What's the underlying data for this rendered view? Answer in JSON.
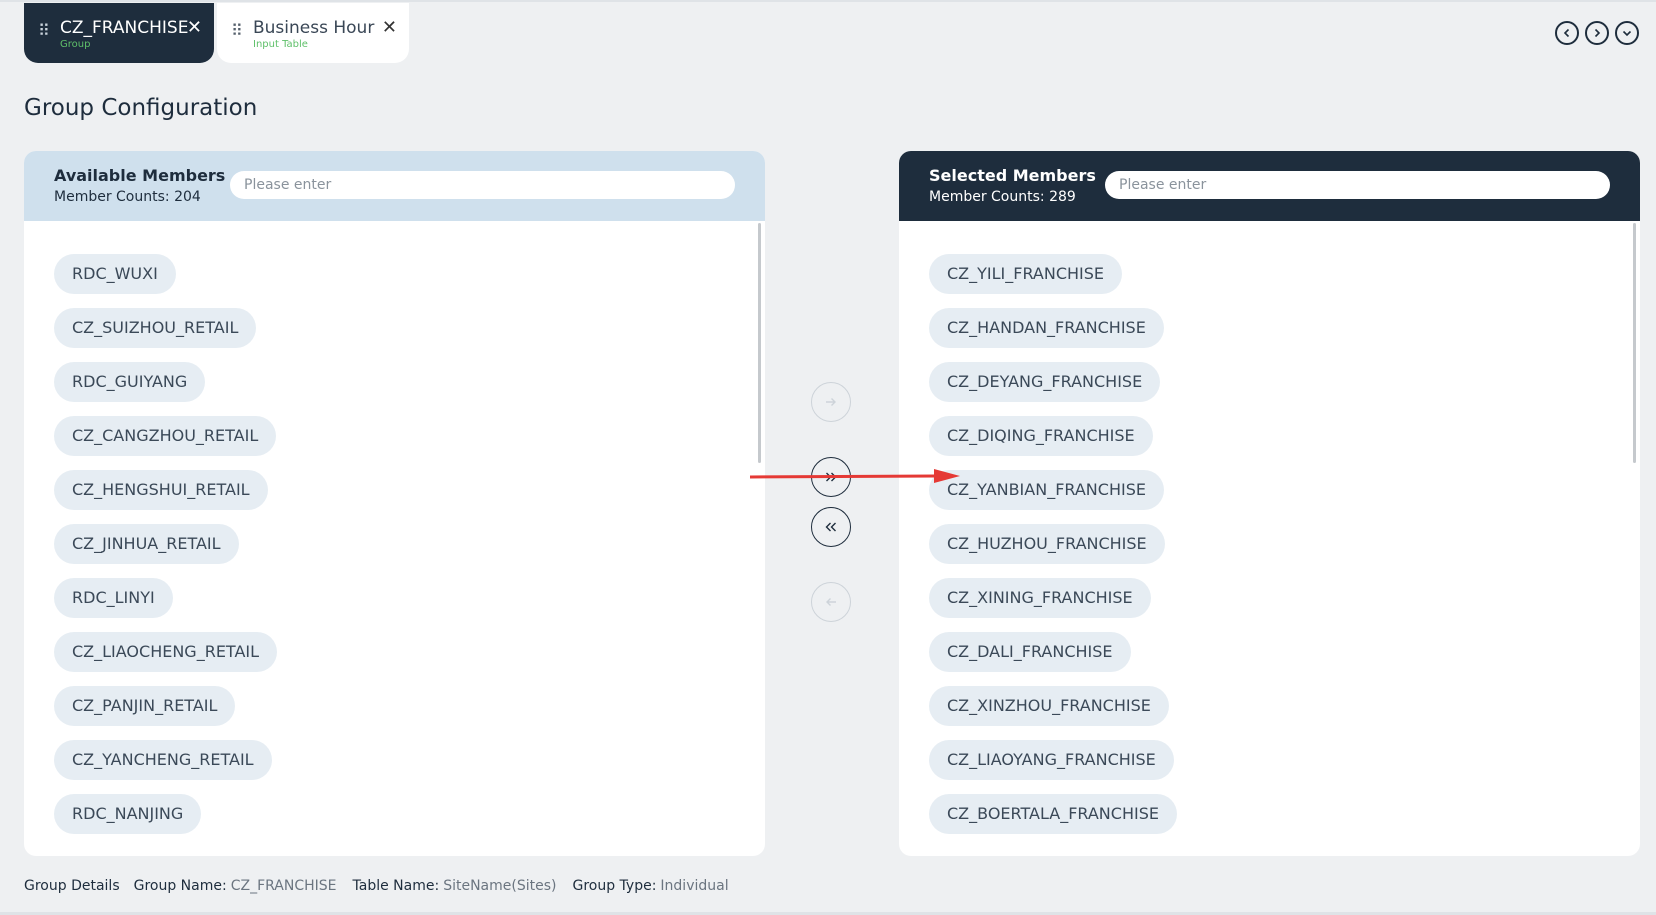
{
  "tabs": [
    {
      "title": "CZ_FRANCHISE",
      "subtitle": "Group",
      "close": "✕"
    },
    {
      "title": "Business Hour",
      "subtitle": "Input Table",
      "close": "✕"
    }
  ],
  "nav": {
    "icons": [
      "chevron-left-icon",
      "chevron-right-icon",
      "chevron-down-icon"
    ]
  },
  "page": {
    "title": "Group Configuration"
  },
  "available": {
    "title": "Available Members",
    "count_label": "Member Counts:",
    "count": "204",
    "search_placeholder": "Please enter",
    "items": [
      "RDC_WUXI",
      "CZ_SUIZHOU_RETAIL",
      "RDC_GUIYANG",
      "CZ_CANGZHOU_RETAIL",
      "CZ_HENGSHUI_RETAIL",
      "CZ_JINHUA_RETAIL",
      "RDC_LINYI",
      "CZ_LIAOCHENG_RETAIL",
      "CZ_PANJIN_RETAIL",
      "CZ_YANCHENG_RETAIL",
      "RDC_NANJING"
    ]
  },
  "selected": {
    "title": "Selected Members",
    "count_label": "Member Counts:",
    "count": "289",
    "search_placeholder": "Please enter",
    "items": [
      "CZ_YILI_FRANCHISE",
      "CZ_HANDAN_FRANCHISE",
      "CZ_DEYANG_FRANCHISE",
      "CZ_DIQING_FRANCHISE",
      "CZ_YANBIAN_FRANCHISE",
      "CZ_HUZHOU_FRANCHISE",
      "CZ_XINING_FRANCHISE",
      "CZ_DALI_FRANCHISE",
      "CZ_XINZHOU_FRANCHISE",
      "CZ_LIAOYANG_FRANCHISE",
      "CZ_BOERTALA_FRANCHISE"
    ]
  },
  "transfer": {
    "move_right": {
      "icon": "arrow-right-icon",
      "enabled": false
    },
    "move_all_right": {
      "icon": "double-chevron-right-icon",
      "enabled": true
    },
    "move_all_left": {
      "icon": "double-chevron-left-icon",
      "enabled": true
    },
    "move_left": {
      "icon": "arrow-left-icon",
      "enabled": false
    }
  },
  "annotation": {
    "color": "#e53935"
  },
  "footer": {
    "details_label": "Group Details",
    "group_name_label": "Group Name:",
    "group_name": "CZ_FRANCHISE",
    "table_name_label": "Table Name:",
    "table_name": "SiteName(Sites)",
    "group_type_label": "Group Type:",
    "group_type": "Individual"
  },
  "colors": {
    "dark": "#1e2d3d",
    "panel_light": "#cfe0ed",
    "chip": "#e6edf3",
    "accent_green": "#5fc06a"
  }
}
